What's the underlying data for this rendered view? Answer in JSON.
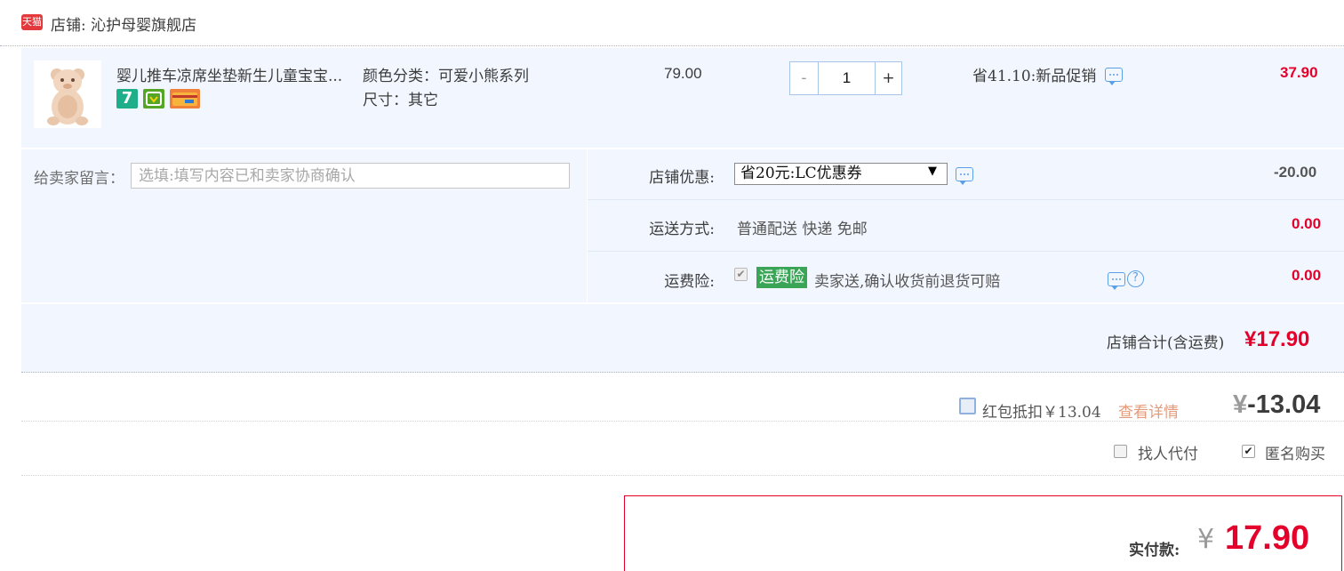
{
  "shop": {
    "logo_text": "天猫",
    "label": "店铺: 沁护母婴旗舰店"
  },
  "item": {
    "title": "婴儿推车凉席坐垫新生儿童宝宝...",
    "sku_color": "颜色分类：可爱小熊系列",
    "sku_size": "尺寸：其它",
    "unit_price": "79.00",
    "quantity": "1",
    "qty_minus": "-",
    "qty_plus": "+",
    "promo": "省41.10:新品促销",
    "subtotal": "37.90",
    "badge_7": "7"
  },
  "message": {
    "label": "给卖家留言：",
    "placeholder": "选填:填写内容已和卖家协商确认"
  },
  "coupon": {
    "label": "店铺优惠:",
    "selected": "省20元:LC优惠券",
    "arrow": "▼",
    "amount": "-20.00"
  },
  "shipping": {
    "label": "运送方式:",
    "value": "普通配送 快递 免邮",
    "amount": "0.00"
  },
  "insurance": {
    "label": "运费险:",
    "check": "✔",
    "tag": "运费险",
    "desc": "卖家送,确认收货前退货可赔",
    "help": "?",
    "amount": "0.00"
  },
  "shop_total": {
    "label": "店铺合计(含运费)",
    "amount": "¥17.90"
  },
  "red_packet": {
    "label": "红包抵扣￥13.04",
    "detail_link": "查看详情",
    "currency": "¥",
    "amount": "-13.04"
  },
  "pay_options": {
    "proxy_label": "找人代付",
    "anon_check": "✔",
    "anon_label": "匿名购买"
  },
  "final": {
    "label": "实付款:",
    "currency": "¥",
    "amount": "17.90"
  },
  "colors": {
    "price_red": "#e4002b",
    "row_bg": "#f2f7ff",
    "insurance_green": "#3aa556",
    "icon_blue": "#5ba0e6"
  }
}
